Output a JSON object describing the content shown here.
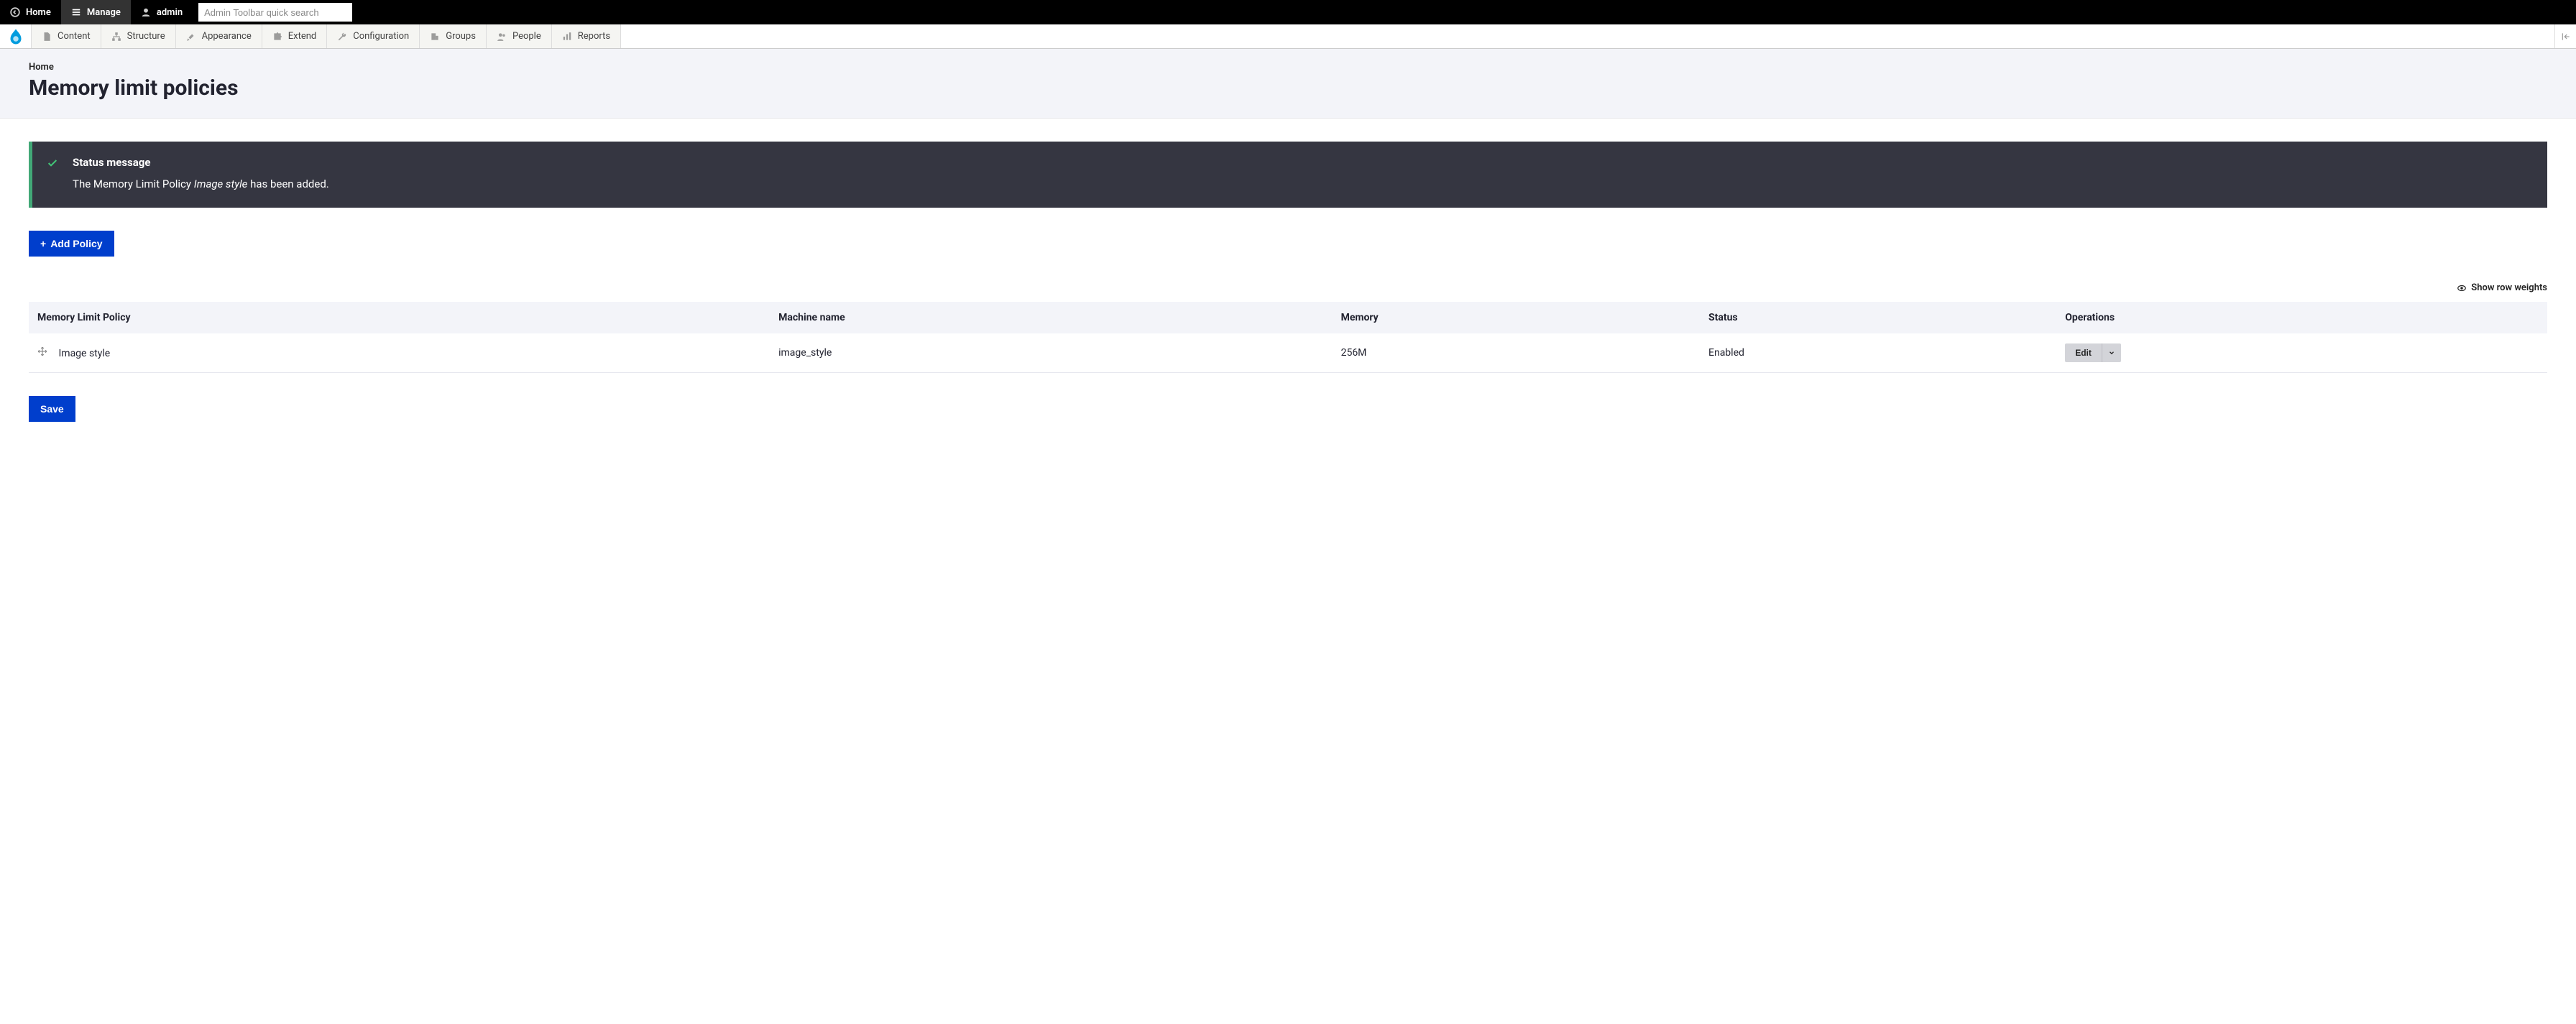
{
  "toolbar": {
    "home": "Home",
    "manage": "Manage",
    "user": "admin",
    "search_placeholder": "Admin Toolbar quick search"
  },
  "admin_menu": {
    "items": [
      {
        "label": "Content"
      },
      {
        "label": "Structure"
      },
      {
        "label": "Appearance"
      },
      {
        "label": "Extend"
      },
      {
        "label": "Configuration"
      },
      {
        "label": "Groups"
      },
      {
        "label": "People"
      },
      {
        "label": "Reports"
      }
    ]
  },
  "breadcrumb": "Home",
  "page_title": "Memory limit policies",
  "status": {
    "title": "Status message",
    "body_prefix": "The Memory Limit Policy ",
    "body_em": "Image style",
    "body_suffix": " has been added."
  },
  "buttons": {
    "add_policy": "Add Policy",
    "save": "Save"
  },
  "row_weights_label": "Show row weights",
  "table": {
    "headers": {
      "name": "Memory Limit Policy",
      "machine": "Machine name",
      "memory": "Memory",
      "status": "Status",
      "ops": "Operations"
    },
    "rows": [
      {
        "name": "Image style",
        "machine": "image_style",
        "memory": "256M",
        "status": "Enabled",
        "op": "Edit"
      }
    ]
  }
}
